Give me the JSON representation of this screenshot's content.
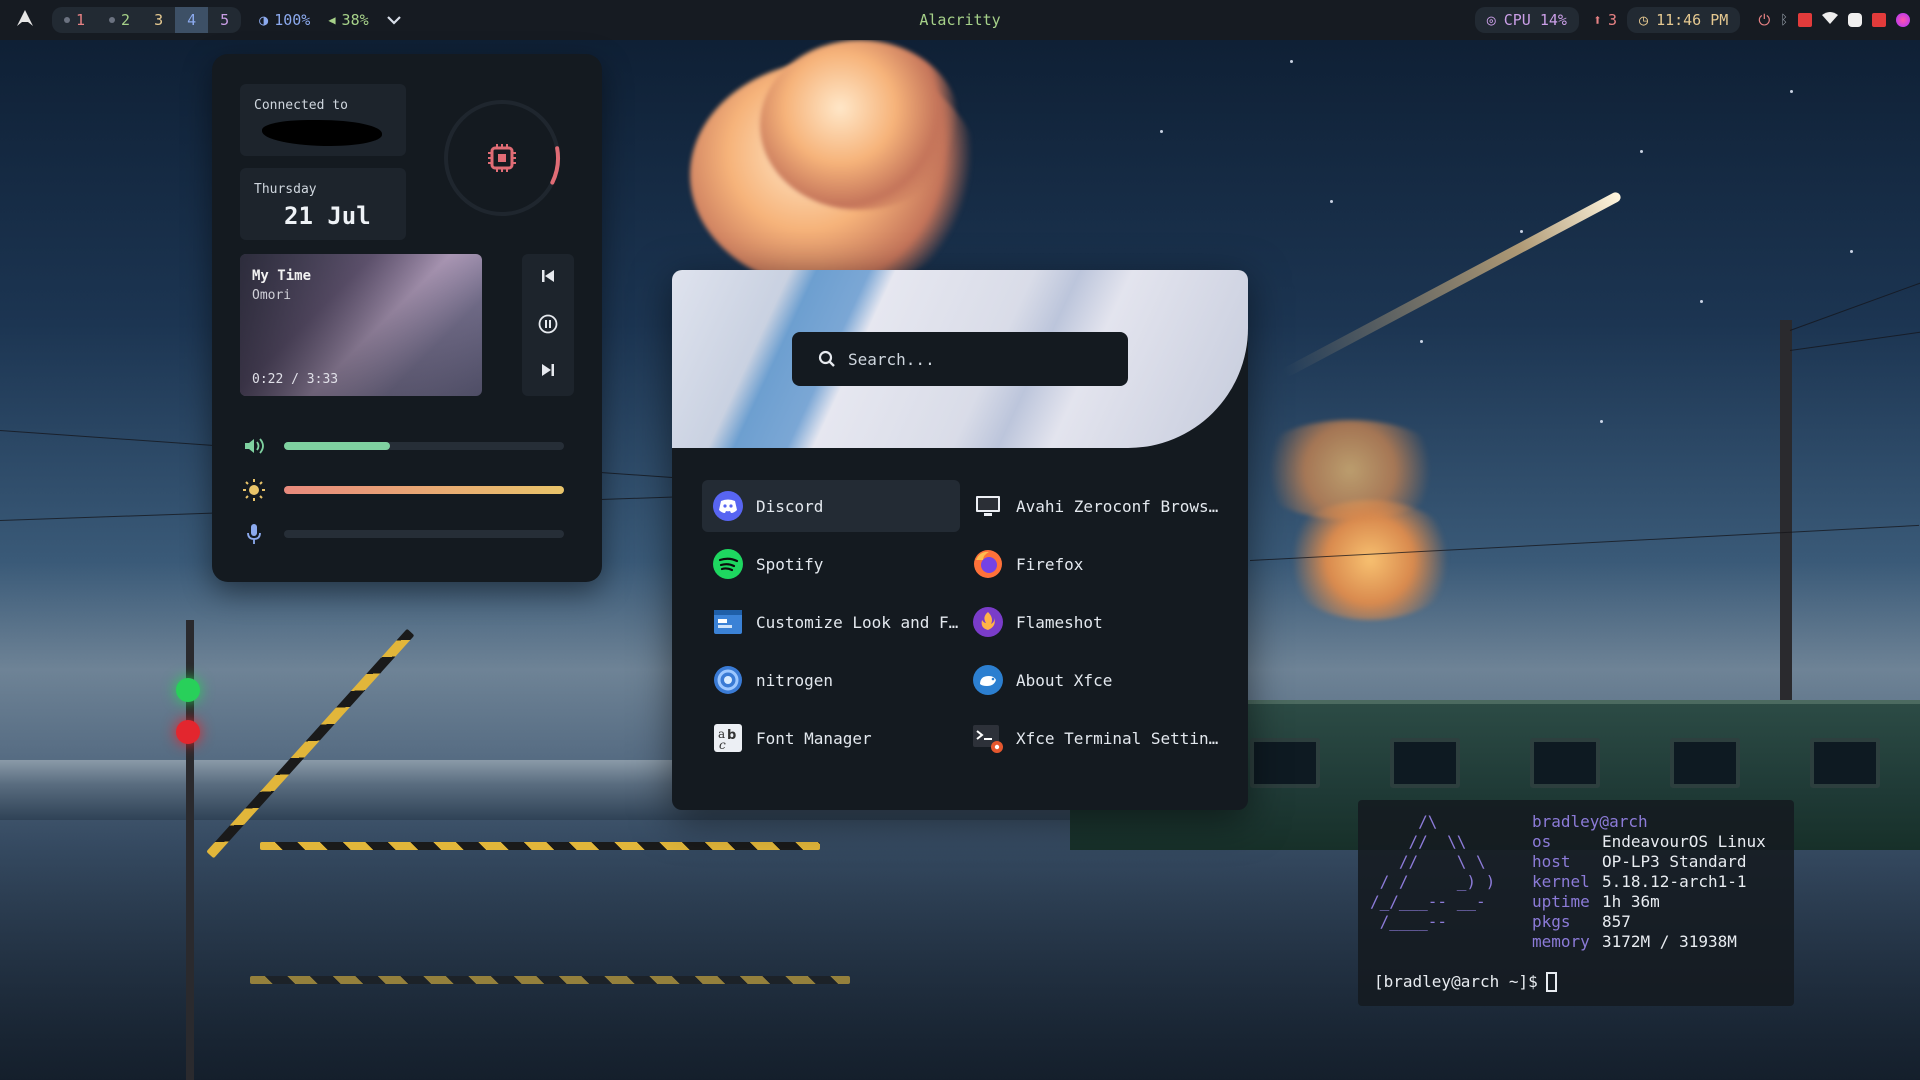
{
  "topbar": {
    "logo_icon": "arch-logo-icon",
    "workspaces": [
      {
        "label": "1",
        "has_dot": true,
        "color": "#e78284",
        "active": false
      },
      {
        "label": "2",
        "has_dot": true,
        "color": "#a6d189",
        "active": false
      },
      {
        "label": "3",
        "has_dot": false,
        "color": "#e5c890",
        "active": false
      },
      {
        "label": "4",
        "has_dot": false,
        "color": "#8caaee",
        "active": true
      },
      {
        "label": "5",
        "has_dot": false,
        "color": "#ca9ee6",
        "active": false
      }
    ],
    "brightness": "100%",
    "volume": "38%",
    "window_title": "Alacritty",
    "cpu": "CPU 14%",
    "updates": "3",
    "clock": "11:46 PM"
  },
  "control_center": {
    "network_label": "Connected to",
    "day": "Thursday",
    "date": "21 Jul",
    "cpu_usage_fraction": 0.1,
    "music": {
      "title": "My Time",
      "artist": "Omori",
      "time": "0:22 / 3:33"
    },
    "volume_level": 0.38,
    "brightness_level": 1.0,
    "mic_level": 0.0,
    "colors": {
      "volume": "#7fd1a0",
      "brightness_start": "#e88a7d",
      "brightness_end": "#e9c46a",
      "accent": "#e06c75"
    }
  },
  "launcher": {
    "search_placeholder": "Search...",
    "apps": [
      {
        "name": "Discord",
        "icon": "discord-icon",
        "selected": true
      },
      {
        "name": "Avahi Zeroconf Brows…",
        "icon": "monitor-icon",
        "selected": false
      },
      {
        "name": "Spotify",
        "icon": "spotify-icon",
        "selected": false
      },
      {
        "name": "Firefox",
        "icon": "firefox-icon",
        "selected": false
      },
      {
        "name": "Customize Look and F…",
        "icon": "appearance-icon",
        "selected": false
      },
      {
        "name": "Flameshot",
        "icon": "flameshot-icon",
        "selected": false
      },
      {
        "name": "nitrogen",
        "icon": "nitrogen-icon",
        "selected": false
      },
      {
        "name": "About Xfce",
        "icon": "xfce-icon",
        "selected": false
      },
      {
        "name": "Font Manager",
        "icon": "font-icon",
        "selected": false
      },
      {
        "name": "Xfce Terminal Settin…",
        "icon": "terminal-settings-icon",
        "selected": false
      }
    ]
  },
  "terminal": {
    "ascii_art": "     /\\\n    //  \\\\\n   //    \\ \\\n / /     _) )\n/_/___-- __-\n /____--",
    "user": "bradley@arch",
    "info": [
      {
        "key": "os",
        "value": "EndeavourOS Linux"
      },
      {
        "key": "host",
        "value": "OP-LP3 Standard"
      },
      {
        "key": "kernel",
        "value": "5.18.12-arch1-1"
      },
      {
        "key": "uptime",
        "value": "1h 36m"
      },
      {
        "key": "pkgs",
        "value": "857"
      },
      {
        "key": "memory",
        "value": "3172M / 31938M"
      }
    ],
    "prompt": "[bradley@arch ~]$"
  }
}
